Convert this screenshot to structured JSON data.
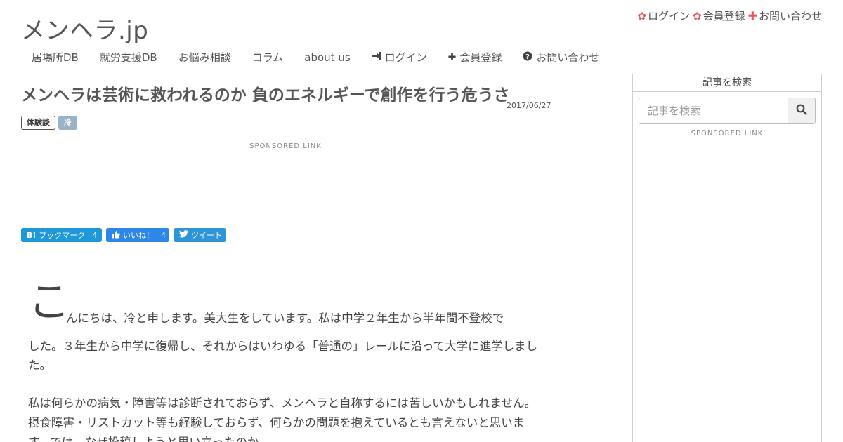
{
  "site": {
    "logo": "メンヘラ.jp"
  },
  "top_links": [
    {
      "label": "ログイン",
      "icon": "gear-icon"
    },
    {
      "label": "会員登録",
      "icon": "gear-icon"
    },
    {
      "label": "お問い合わせ",
      "icon": "plus-icon"
    }
  ],
  "nav": [
    {
      "label": "居場所DB"
    },
    {
      "label": "就労支援DB"
    },
    {
      "label": "お悩み相談"
    },
    {
      "label": "コラム"
    },
    {
      "label": "about us"
    },
    {
      "label": "ログイン",
      "icon": "sign-in-icon"
    },
    {
      "label": "会員登録",
      "icon": "plus-icon"
    },
    {
      "label": "お問い合わせ",
      "icon": "question-circle-icon"
    }
  ],
  "article": {
    "title": "メンヘラは芸術に救われるのか 負のエネルギーで創作を行う危うさ",
    "date": "2017/06/27",
    "tags": [
      "体験談",
      "冷"
    ],
    "sponsored": "SPONSORED LINK",
    "share": {
      "hatena_label": "ブックマーク",
      "hatena_count": "4",
      "fb_label": "いいね！",
      "fb_count": "4",
      "tw_label": "ツイート"
    },
    "dropcap": "こ",
    "para1_line1": "んにちは、冷と申します。美大生をしています。私は中学２年生から半年間不登校で",
    "para1_rest": "した。３年生から中学に復帰し、それからはいわゆる「普通の」レールに沿って大学に進学しました。",
    "para2": "私は何らかの病気・障害等は診断されておらず、メンヘラと自称するには苦しいかもしれません。摂食障害・リストカット等も経験しておらず、何らかの問題を抱えているとも言えないと思います。では、なぜ投稿しようと思い立ったのか。"
  },
  "sidebar": {
    "title": "記事を検索",
    "search_placeholder": "記事を検索",
    "sponsored": "SPONSORED LINK"
  },
  "colors": {
    "accent_red": "#e45a5a",
    "hatena_blue": "#1e98d8",
    "facebook_blue": "#2c87e8",
    "twitter_blue": "#2f95d8",
    "tag_fill": "#9bb3c7"
  }
}
